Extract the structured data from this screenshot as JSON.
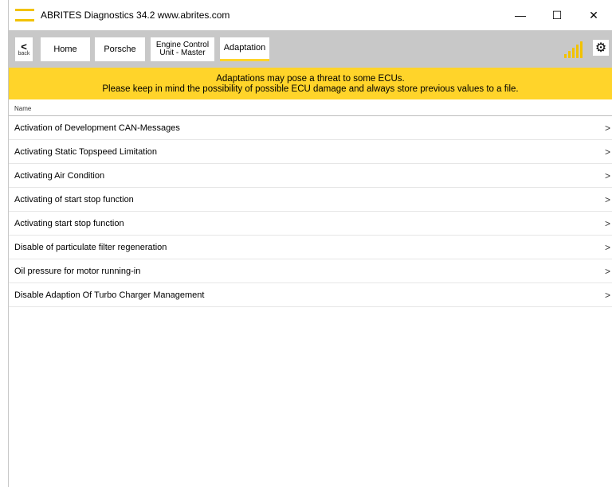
{
  "window": {
    "title": "ABRITES Diagnostics 34.2   www.abrites.com",
    "minimize": "—",
    "maximize": "☐",
    "close": "✕"
  },
  "toolbar": {
    "back_chevron": "<",
    "back_label": "back",
    "home": "Home",
    "porsche": "Porsche",
    "ecu_line1": "Engine Control",
    "ecu_line2": "Unit - Master",
    "adaptation": "Adaptation",
    "accent": "#ffd42a"
  },
  "banner": {
    "line1": "Adaptations may pose a threat to some ECUs.",
    "line2": "Please keep in mind the possibility of possible ECU damage and always store previous values to a file.",
    "color": "#ffd42a"
  },
  "list": {
    "column_name": "Name",
    "arrow": ">",
    "items": [
      "Activation of Development CAN-Messages",
      "Activating Static Topspeed Limitation",
      "Activating Air Condition",
      "Activating of start stop function",
      "Activating start stop function",
      "Disable of particulate filter regeneration",
      "Oil pressure for motor running-in",
      "Disable Adaption Of Turbo Charger Management"
    ]
  },
  "icons": {
    "signal": "signal-strength-icon",
    "gear": "gear-icon",
    "gear_glyph": "⚙"
  }
}
